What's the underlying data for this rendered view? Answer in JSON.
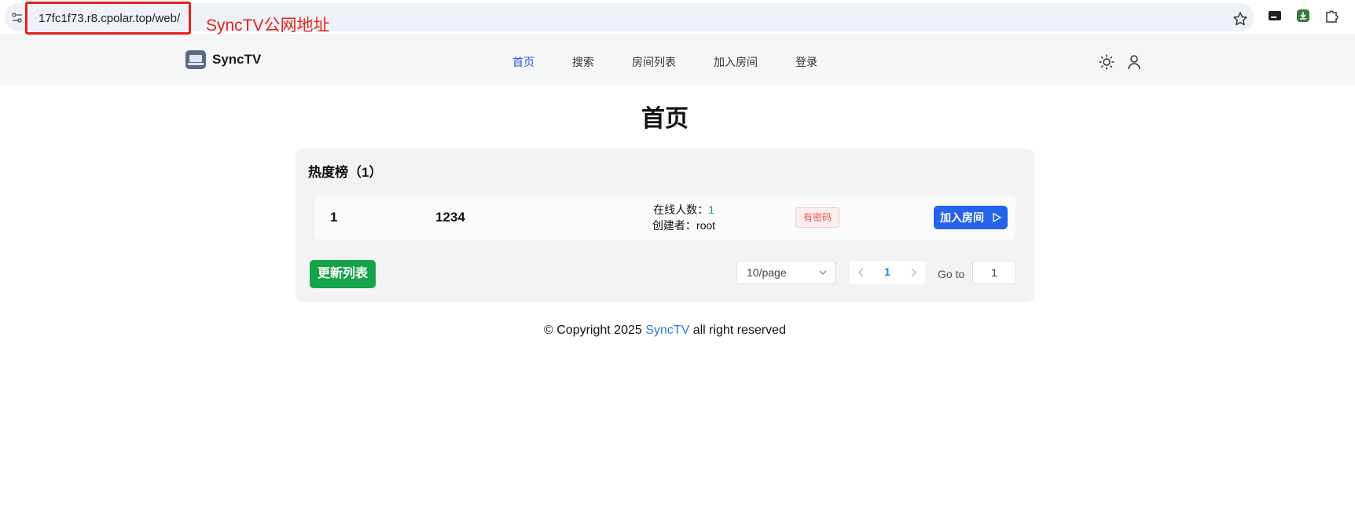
{
  "browser": {
    "url": "17fc1f73.r8.cpolar.top/web/",
    "annotation": "SyncTV公网地址"
  },
  "header": {
    "logo_text": "SyncTV",
    "nav": [
      "首页",
      "搜索",
      "房间列表",
      "加入房间",
      "登录"
    ]
  },
  "main": {
    "title": "首页",
    "hot_list_title": "热度榜（1）",
    "rooms": [
      {
        "rank": "1",
        "name": "1234",
        "online_label": "在线人数：",
        "online_count": "1",
        "creator_label": "创建者：",
        "creator": "root",
        "badge": "有密码",
        "join_label": "加入房间"
      }
    ],
    "refresh_label": "更新列表",
    "pagination": {
      "page_size": "10/page",
      "current_page": "1",
      "goto_label": "Go to",
      "goto_value": "1"
    }
  },
  "footer": {
    "prefix": "© Copyright 2025",
    "link": "SyncTV",
    "suffix": "all right reserved"
  },
  "colors": {
    "accent": "#2563eb",
    "success": "#16a34a",
    "danger": "#e25454",
    "annotation": "#e8221a"
  }
}
